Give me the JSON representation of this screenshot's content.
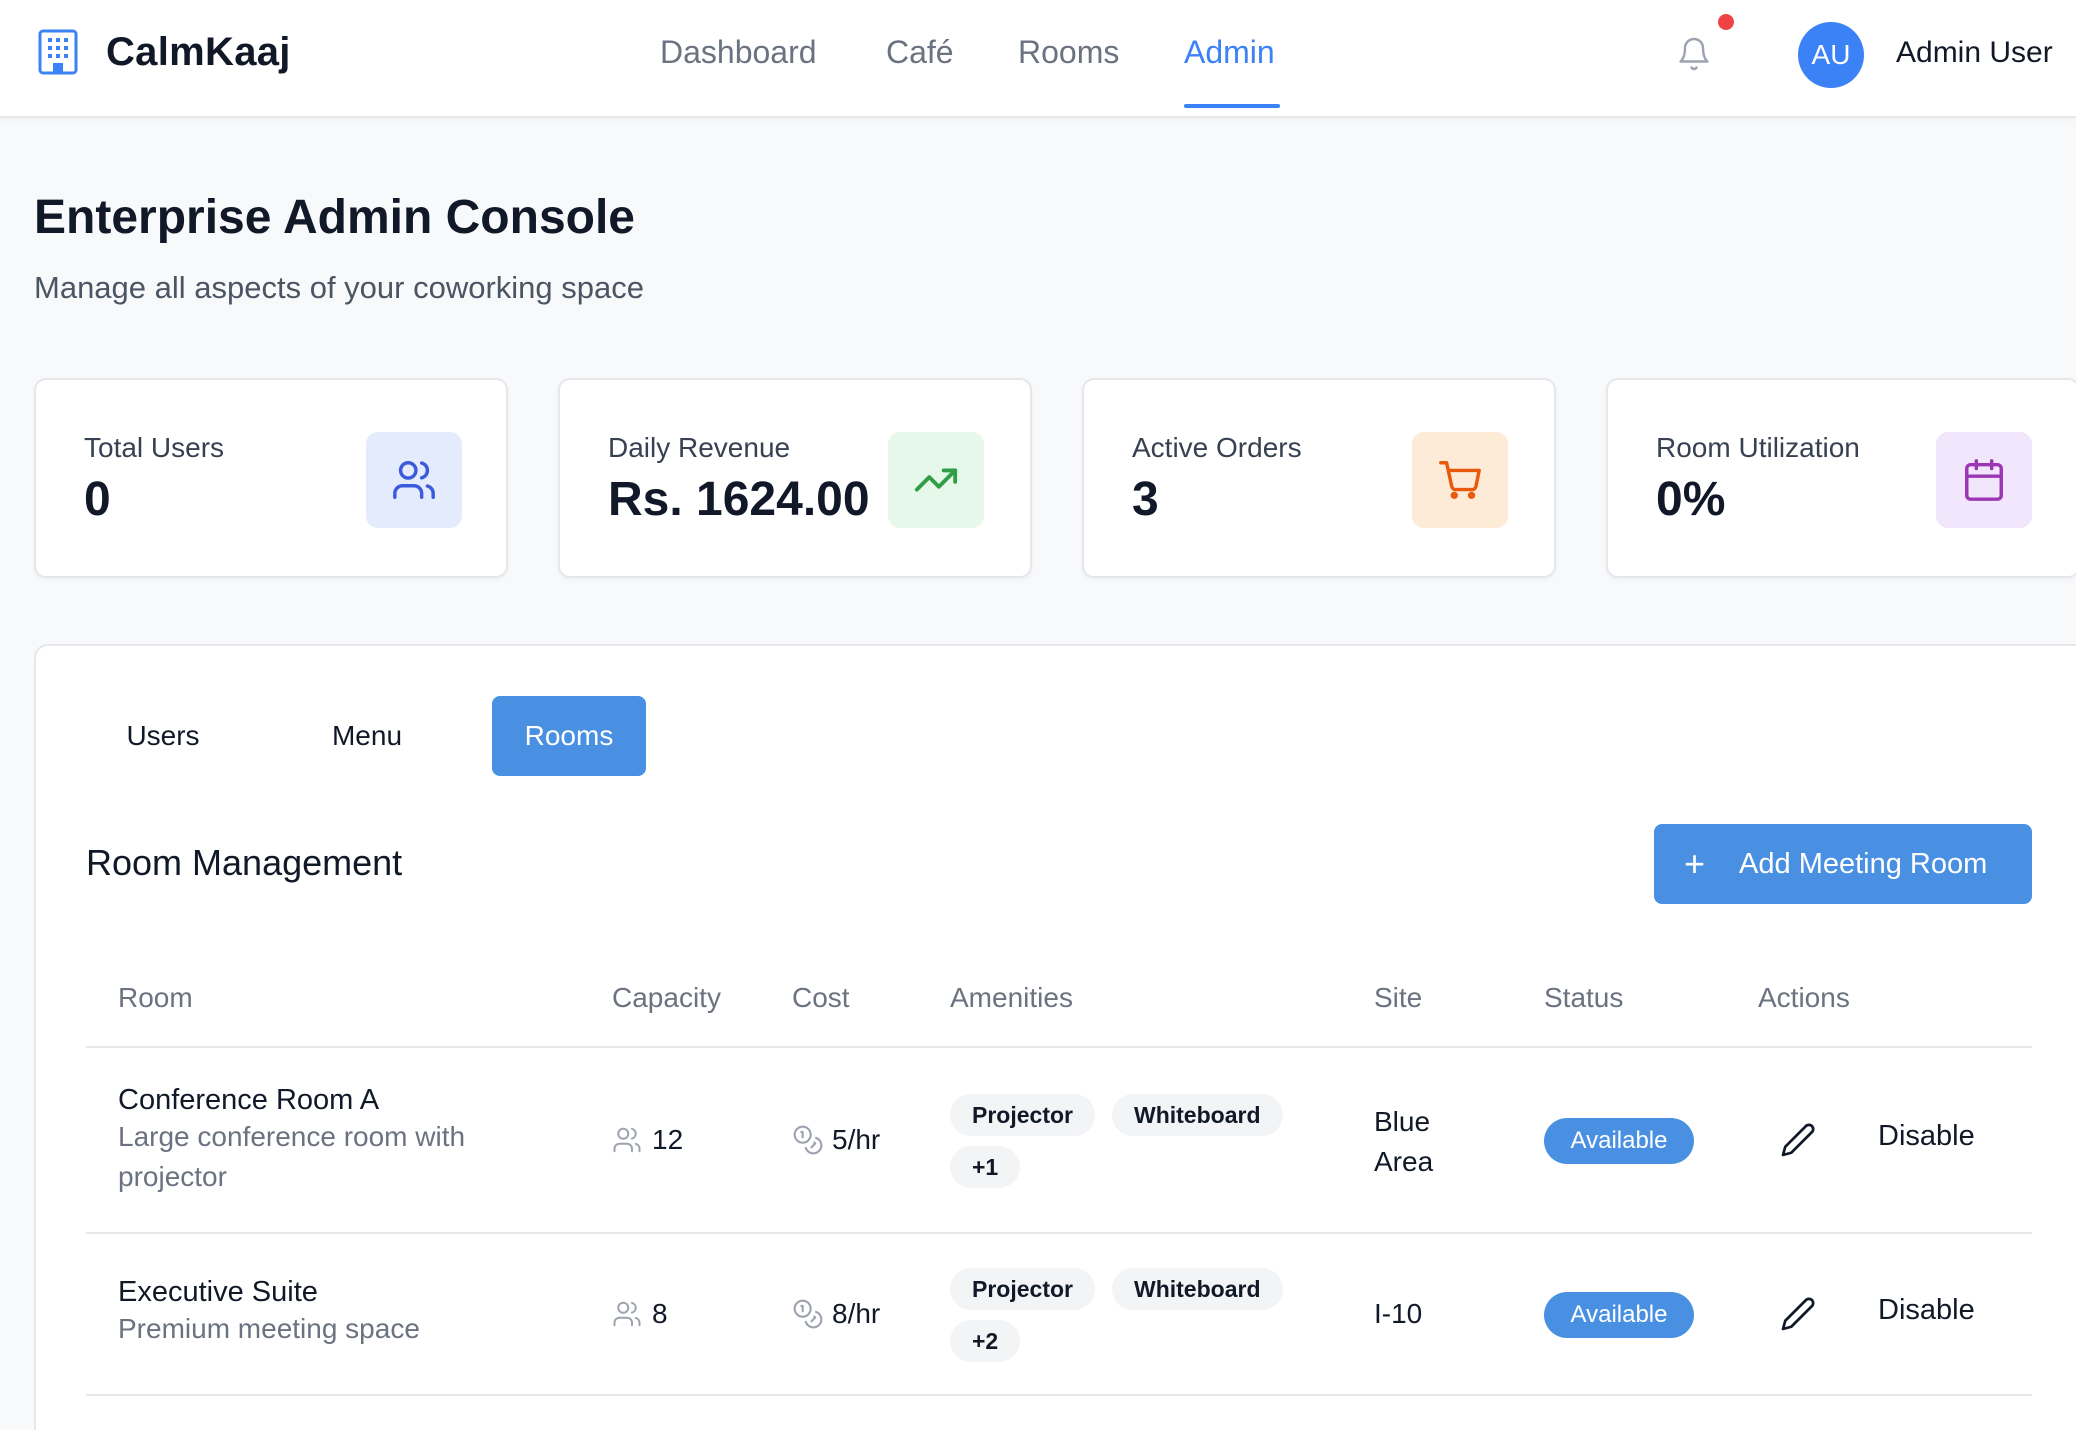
{
  "app": {
    "name": "CalmKaaj",
    "logo_icon": "building-icon"
  },
  "nav": {
    "items": [
      {
        "label": "Dashboard",
        "active": false
      },
      {
        "label": "Café",
        "active": false
      },
      {
        "label": "Rooms",
        "active": false
      },
      {
        "label": "Admin",
        "active": true
      }
    ]
  },
  "header": {
    "notification_icon": "bell-icon",
    "has_unread": true,
    "avatar_initials": "AU",
    "user_name": "Admin User"
  },
  "page": {
    "title": "Enterprise Admin Console",
    "subtitle": "Manage all aspects of your coworking space"
  },
  "stats": [
    {
      "label": "Total Users",
      "value": "0",
      "icon": "users-icon",
      "icon_color": "#3b5bdb",
      "icon_bg": "#e3ebfc"
    },
    {
      "label": "Daily Revenue",
      "value": "Rs. 1624.00",
      "icon": "trending-up-icon",
      "icon_color": "#2f9e44",
      "icon_bg": "#e6f8ea"
    },
    {
      "label": "Active Orders",
      "value": "3",
      "icon": "cart-icon",
      "icon_color": "#e8590c",
      "icon_bg": "#fdebd7"
    },
    {
      "label": "Room Utilization",
      "value": "0%",
      "icon": "calendar-icon",
      "icon_color": "#9c36b5",
      "icon_bg": "#f1e6fb"
    }
  ],
  "tabs": [
    {
      "label": "Users",
      "active": false
    },
    {
      "label": "Menu",
      "active": false
    },
    {
      "label": "Rooms",
      "active": true
    }
  ],
  "room_management": {
    "title": "Room Management",
    "add_button_label": "Add Meeting Room",
    "columns": [
      "Room",
      "Capacity",
      "Cost",
      "Amenities",
      "Site",
      "Status",
      "Actions"
    ],
    "rows": [
      {
        "name": "Conference Room A",
        "description_line1": "Large conference room with",
        "description_line2": "projector",
        "capacity": "12",
        "cost": "5/hr",
        "amenities": [
          "Projector",
          "Whiteboard"
        ],
        "more_amenities": "+1",
        "site_line1": "Blue",
        "site_line2": "Area",
        "status": "Available",
        "action_label": "Disable"
      },
      {
        "name": "Executive Suite",
        "description_line1": "Premium meeting space",
        "capacity": "8",
        "cost": "8/hr",
        "amenities": [
          "Projector",
          "Whiteboard"
        ],
        "more_amenities": "+2",
        "site_line1": "I-10",
        "status": "Available",
        "action_label": "Disable"
      }
    ]
  },
  "colors": {
    "accent": "#3b82f6",
    "button": "#4a90e2",
    "notification_dot": "#ef4444"
  }
}
